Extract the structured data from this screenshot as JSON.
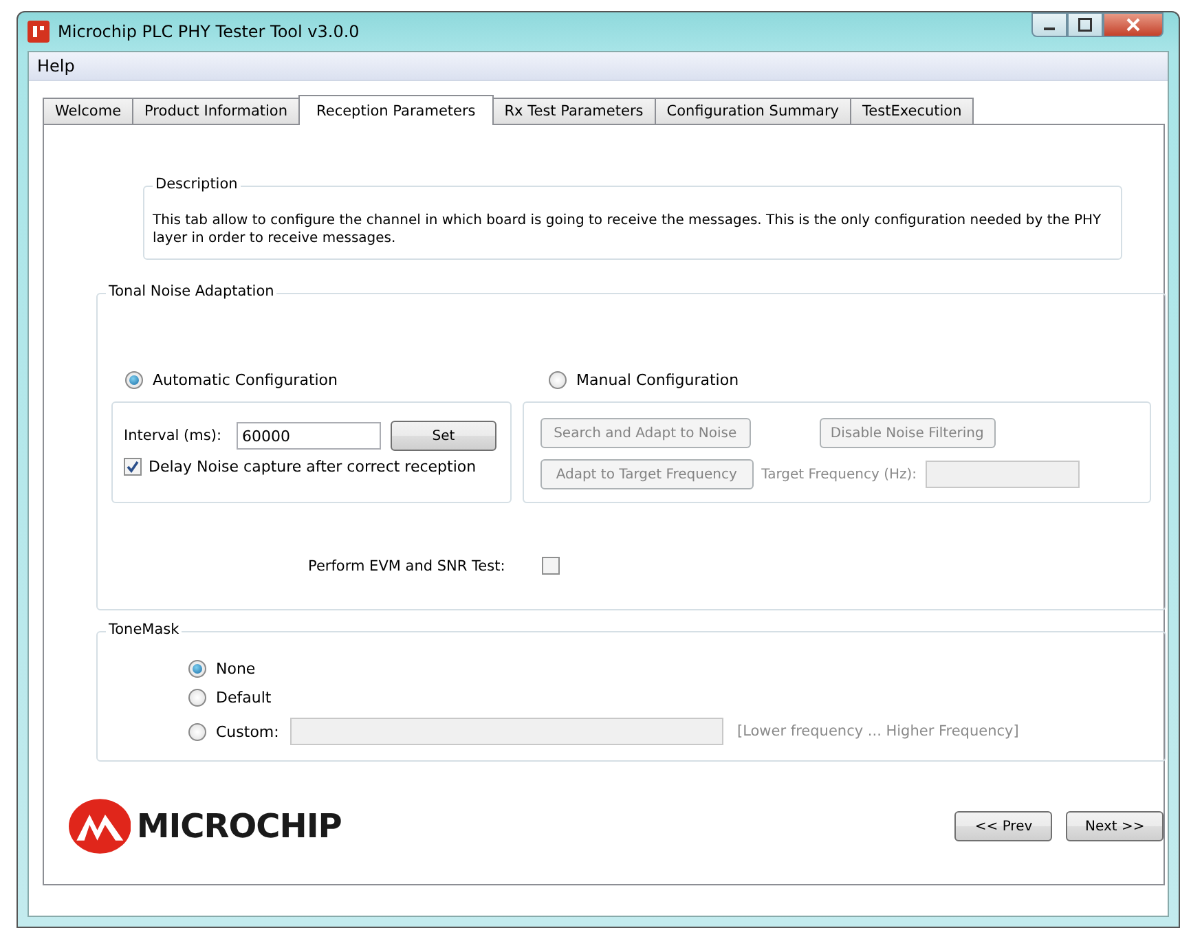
{
  "window": {
    "title": "Microchip PLC PHY Tester Tool v3.0.0"
  },
  "menu": [
    "Help"
  ],
  "tabs": [
    {
      "label": "Welcome",
      "selected": false
    },
    {
      "label": "Product Information",
      "selected": false
    },
    {
      "label": "Reception Parameters",
      "selected": true
    },
    {
      "label": "Rx Test Parameters",
      "selected": false
    },
    {
      "label": "Configuration Summary",
      "selected": false
    },
    {
      "label": "TestExecution",
      "selected": false
    }
  ],
  "description": {
    "title": "Description",
    "text": "This tab allow to configure the channel in which board is going to receive the messages. This is the only configuration needed by the PHY layer in order to receive messages."
  },
  "tonal_noise": {
    "title": "Tonal Noise Adaptation",
    "automatic": {
      "label": "Automatic Configuration",
      "selected": true,
      "interval_label": "Interval (ms):",
      "interval_value": "60000",
      "set_button": "Set",
      "delay_label": "Delay Noise capture after correct reception",
      "delay_checked": true
    },
    "manual": {
      "label": "Manual Configuration",
      "selected": false,
      "search_button": {
        "label": "Search and Adapt to Noise",
        "disabled": true
      },
      "disable_button": {
        "label": "Disable Noise Filtering",
        "disabled": true
      },
      "adapt_button": {
        "label": "Adapt to Target Frequency",
        "disabled": true
      },
      "target_label": "Target Frequency (Hz):",
      "target_disabled": true
    },
    "evm": {
      "label": "Perform EVM and SNR Test:",
      "checked": false
    }
  },
  "tonemask": {
    "title": "ToneMask",
    "options": [
      {
        "label": "None",
        "selected": true
      },
      {
        "label": "Default",
        "selected": false
      },
      {
        "label": "Custom:",
        "selected": false
      }
    ],
    "custom_disabled": true,
    "hint": "[Lower frequency ... Higher Frequency]"
  },
  "logo_text": "MICROCHIP",
  "nav": {
    "prev": "<< Prev",
    "next": "Next >>"
  }
}
